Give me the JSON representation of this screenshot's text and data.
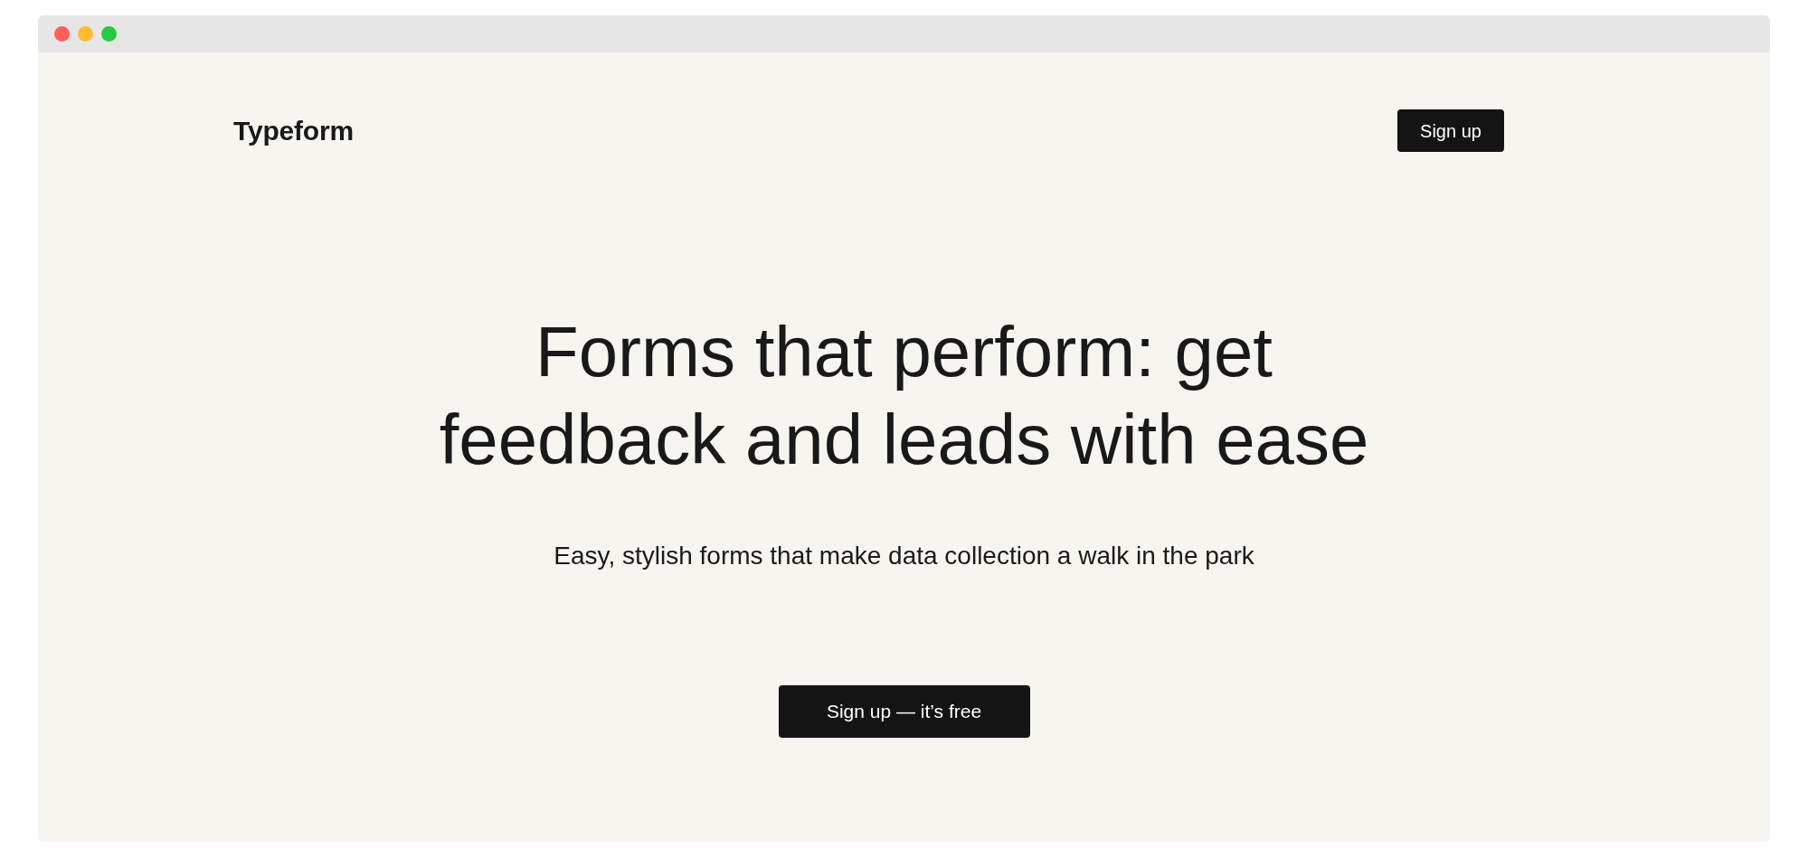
{
  "window": {
    "controls": [
      {
        "color": "#ff5f57"
      },
      {
        "color": "#febc2e"
      },
      {
        "color": "#28c840"
      }
    ]
  },
  "navbar": {
    "logo": "Typeform",
    "button": "Sign up"
  },
  "hero": {
    "headline": "Forms that perform: get feedback and leads with ease",
    "subtitle": "Easy, stylish forms that make data collection a walk in the park",
    "cta": "Sign up — it’s free"
  }
}
